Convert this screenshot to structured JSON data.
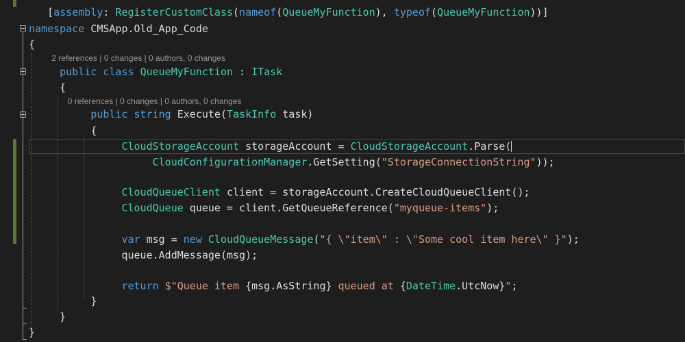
{
  "colors": {
    "background": "#1e1e1e",
    "keyword": "#569cd6",
    "type": "#4ec9b0",
    "string": "#d69d85",
    "plain": "#dcdcdc",
    "codelens": "#999999",
    "change_bar": "#577a2f"
  },
  "codelens": {
    "class_refs": "2 references | 0 changes | 0 authors, 0 changes",
    "method_refs": "0 references | 0 changes | 0 authors, 0 changes"
  },
  "code": {
    "l1": {
      "t1": "[",
      "t2": "assembly",
      "t3": ": ",
      "t4": "RegisterCustomClass",
      "t5": "(",
      "t6": "nameof",
      "t7": "(",
      "t8": "QueueMyFunction",
      "t9": "), ",
      "t10": "typeof",
      "t11": "(",
      "t12": "QueueMyFunction",
      "t13": "))]"
    },
    "l2": {
      "t1": "namespace",
      "t2": " CMSApp.Old_App_Code"
    },
    "l3": {
      "t1": "{"
    },
    "l4": {
      "t1": "public",
      "t2": " ",
      "t3": "class",
      "t4": " ",
      "t5": "QueueMyFunction",
      "t6": " : ",
      "t7": "ITask"
    },
    "l5": {
      "t1": "{"
    },
    "l6": {
      "t1": "public",
      "t2": " ",
      "t3": "string",
      "t4": " Execute(",
      "t5": "TaskInfo",
      "t6": " task)"
    },
    "l7": {
      "t1": "{"
    },
    "l8": {
      "t1": "CloudStorageAccount",
      "t2": " storageAccount = ",
      "t3": "CloudStorageAccount",
      "t4": ".Parse("
    },
    "l9": {
      "t1": "CloudConfigurationManager",
      "t2": ".GetSetting(",
      "t3": "\"StorageConnectionString\"",
      "t4": "));"
    },
    "l10": {
      "t1": "CloudQueueClient",
      "t2": " client = storageAccount.CreateCloudQueueClient();"
    },
    "l11": {
      "t1": "CloudQueue",
      "t2": " queue = client.GetQueueReference(",
      "t3": "\"myqueue-items\"",
      "t4": ");"
    },
    "l12": {
      "t1": "var",
      "t2": " msg = ",
      "t3": "new",
      "t4": " ",
      "t5": "CloudQueueMessage",
      "t6": "(",
      "t7": "\"{ \\\"item\\\" : \\\"Some cool item here\\\" }\"",
      "t8": ");"
    },
    "l13": {
      "t1": "queue.AddMessage(msg);"
    },
    "l14": {
      "t1": "return",
      "t2": " ",
      "t3": "$\"Queue item ",
      "t4": "{msg.AsString}",
      "t5": " queued at ",
      "t6": "{",
      "t7": "DateTime",
      "t8": ".UtcNow}",
      "t9": "\"",
      "t10": ";"
    },
    "l15": {
      "t1": "}"
    },
    "l16": {
      "t1": "}"
    },
    "l17": {
      "t1": "}"
    }
  }
}
